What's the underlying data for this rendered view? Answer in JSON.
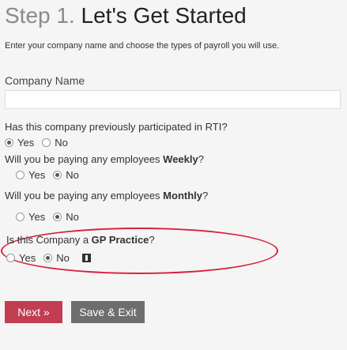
{
  "header": {
    "step": "Step 1.",
    "title": "Let's Get Started",
    "subtitle": "Enter your company name and choose the types of payroll you will use."
  },
  "company": {
    "label": "Company Name",
    "value": "",
    "placeholder": ""
  },
  "questions": {
    "rti": {
      "text": "Has this company previously participated in RTI?",
      "yes": "Yes",
      "no": "No",
      "selected": "yes"
    },
    "weekly": {
      "text_pre": "Will you be paying any employees ",
      "text_bold": "Weekly",
      "text_post": "?",
      "yes": "Yes",
      "no": "No",
      "selected": "no"
    },
    "monthly": {
      "text_pre": "Will you be paying any employees ",
      "text_bold": "Monthly",
      "text_post": "?",
      "yes": "Yes",
      "no": "No",
      "selected": "no"
    },
    "gp": {
      "text_pre": "Is this Company a ",
      "text_bold": "GP Practice",
      "text_post": "?",
      "yes": "Yes",
      "no": "No",
      "selected": "no"
    }
  },
  "buttons": {
    "next": "Next »",
    "save_exit": "Save & Exit"
  },
  "colors": {
    "highlight": "#d81f3d",
    "next_button": "#c13d52",
    "save_button": "#6e6e6e"
  }
}
